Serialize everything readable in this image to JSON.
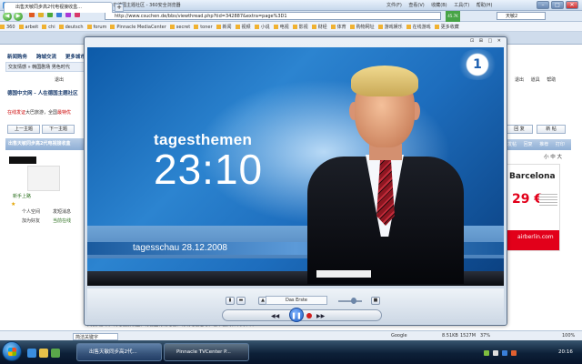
{
  "browser": {
    "title": "出售天敏同步高2代电视接收盒 - 德国中文网 - 人在德国主题社区 - 360安全浏览器",
    "menus": [
      "文件(F)",
      "查看(V)",
      "收藏(B)",
      "工具(T)",
      "帮助(H)"
    ],
    "url": "http://www.csuchen.de/bbs/viewthread.php?tid=342887&extra=page%3D1",
    "speed_label": "45.7K",
    "search_engine": "天敏2",
    "favorites": [
      "360",
      "arbeit",
      "chi",
      "deutsch",
      "forum",
      "Pinnacle MediaCenter",
      "secret",
      "toner",
      "新闻",
      "视频",
      "小说",
      "电视",
      "影视",
      "财经",
      "体育",
      "购物网址",
      "游戏娱乐",
      "在线游戏",
      "更多收藏"
    ],
    "active_tab": "出售天敏同步高2代电视接收盒..."
  },
  "forum": {
    "nav": [
      "新闻购务",
      "跨城交流",
      "更多城市"
    ],
    "subnav": "交友情感 » 韩国剧场  男色时代",
    "exit_label": "退出",
    "site_title": "德国中文网 - 人在德国主题社区",
    "notice_red": "在线发证",
    "notice_mid": "大巴旅游，全国",
    "notice_red2": "最特优",
    "prev_label": "上一主题",
    "next_label": "下一主题",
    "thread_title": "出售天敏同步高2代电视接收盒",
    "newbie_label": "新手上路",
    "stars": "★",
    "personal_space": "个人空间",
    "send_msg": "发短消息",
    "add_friend": "加为好友",
    "online": "当前在线",
    "right_menu": [
      "退出",
      "道具",
      "帮助"
    ],
    "reply_label": "回 复",
    "newpost_label": "新 帖",
    "post_actions": [
      "发帖",
      "回复",
      "推荐",
      "打印"
    ],
    "font_size": "小 中 大",
    "bottom_text": "天敏同步高2代电视接收盒，有德国有线电视、有线电视信号，看中德文和中文节目"
  },
  "ad": {
    "city": "Barcelona",
    "price": "29 €",
    "brand": "airberlin.com"
  },
  "player": {
    "titlebar_icons": "⊡ ⊞ □ ✕",
    "video_logo": "tagesthemen",
    "video_time": "23:10",
    "ticker": "tagesschau 28.12.2008",
    "channel_logo": "1",
    "channel_name": "Das Erste",
    "play_icon": "❚❚"
  },
  "statusbar": {
    "search_text": "简洁关键字",
    "zoom": "100%",
    "stats": [
      "8.51KB",
      "1527M",
      "37%"
    ],
    "google_label": "Google"
  },
  "taskbar": {
    "tasks": [
      "出售天敏同步高2代...",
      "Pinnacle TVCenter P..."
    ],
    "clock": "20:16"
  }
}
